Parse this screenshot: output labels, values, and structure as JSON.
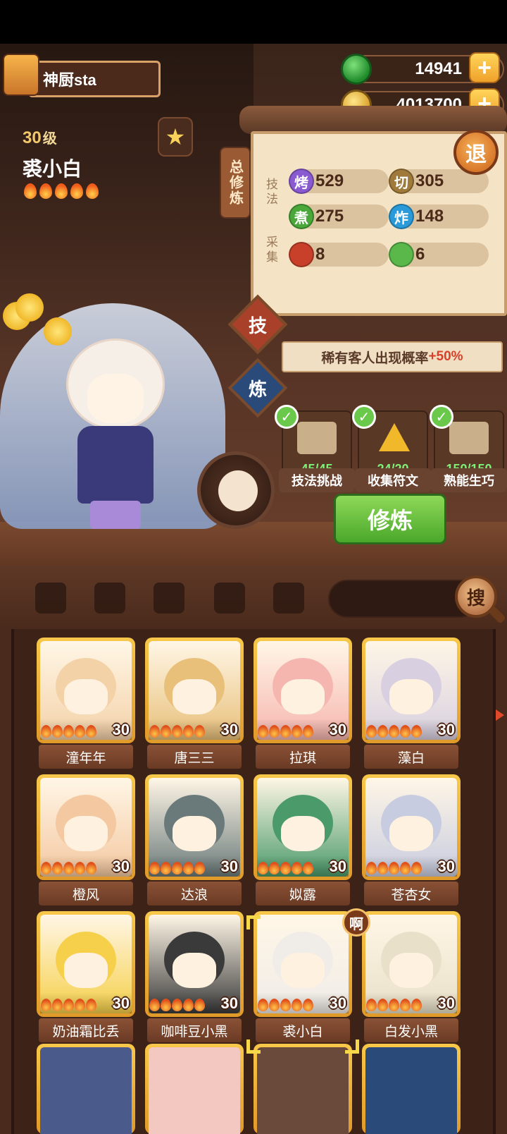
{
  "player": {
    "title": "神厨sta"
  },
  "currency": {
    "jade": "14941",
    "gold": "4013700"
  },
  "character": {
    "level": "30",
    "level_unit": "级",
    "name": "裘小白",
    "flame_count": 5
  },
  "panel": {
    "side_tag": "总修炼",
    "section_skill": "技法",
    "section_gather": "采集",
    "exit_label": "退",
    "stats": [
      {
        "icon": "烤",
        "value": "529"
      },
      {
        "icon": "切",
        "value": "305"
      },
      {
        "icon": "煮",
        "value": "275"
      },
      {
        "icon": "炸",
        "value": "148"
      },
      {
        "icon": "meat-icon",
        "value": "8"
      },
      {
        "icon": "cabbage-icon",
        "value": "6"
      }
    ]
  },
  "tabs": {
    "skill": "技",
    "train": "炼"
  },
  "bonus": {
    "text": "稀有客人出现概率",
    "pct": "+50%"
  },
  "tasks": [
    {
      "progress": "45/45",
      "label": "技法挑战"
    },
    {
      "progress": "24/20",
      "label": "收集符文"
    },
    {
      "progress": "150/150",
      "label": "熟能生巧"
    }
  ],
  "train_button": "修炼",
  "search": {
    "button": "搜"
  },
  "roster": [
    {
      "name": "潼年年",
      "level": "30",
      "color": "#f4d2a8"
    },
    {
      "name": "唐三三",
      "level": "30",
      "color": "#e8c07a"
    },
    {
      "name": "拉琪",
      "level": "30",
      "color": "#f6b6b0"
    },
    {
      "name": "藻白",
      "level": "30",
      "color": "#d8d0e0"
    },
    {
      "name": "橙风",
      "level": "30",
      "color": "#f4c8a0"
    },
    {
      "name": "达浪",
      "level": "30",
      "color": "#6a7a7a"
    },
    {
      "name": "姒露",
      "level": "30",
      "color": "#4a9a6a"
    },
    {
      "name": "苍杏女",
      "level": "30",
      "color": "#c8cce0"
    },
    {
      "name": "奶油霜比丢",
      "level": "30",
      "color": "#f6d04a"
    },
    {
      "name": "咖啡豆小黑",
      "level": "30",
      "color": "#3a3a3a"
    },
    {
      "name": "裘小白",
      "level": "30",
      "color": "#f0ece8"
    },
    {
      "name": "白发小黑",
      "level": "30",
      "color": "#e8e0c8"
    }
  ],
  "bubble": "啊"
}
